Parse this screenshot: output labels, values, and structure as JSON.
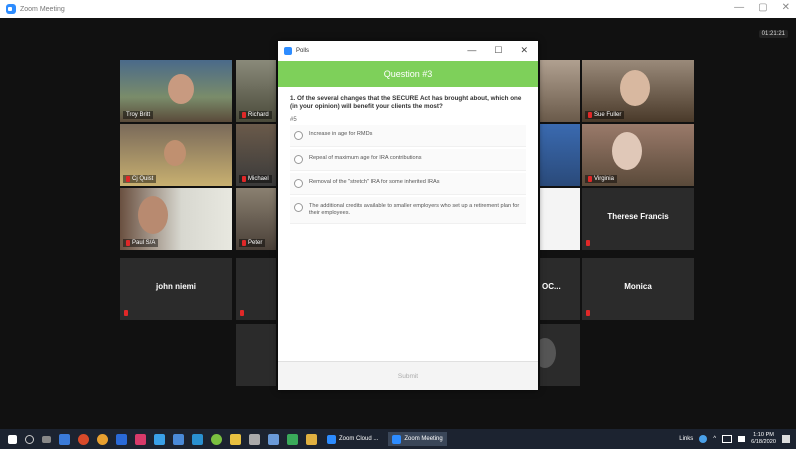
{
  "window": {
    "title": "Zoom Meeting",
    "controls": [
      "—",
      "▢",
      "✕"
    ]
  },
  "meeting": {
    "timer": "01:21:21"
  },
  "participants": [
    {
      "name": "Troy Britt",
      "muted": false
    },
    {
      "name": "Richard",
      "muted": true
    },
    {
      "name": "Sue Fuller",
      "muted": true
    },
    {
      "name": "Cj Quist",
      "muted": true
    },
    {
      "name": "Michael",
      "muted": true
    },
    {
      "name": "Virginia",
      "muted": true
    },
    {
      "name": "Paul S/A",
      "muted": true
    },
    {
      "name": "Peter",
      "muted": true
    },
    {
      "name": "Therese Francis",
      "muted": true
    },
    {
      "name": "john niemi",
      "muted": true
    },
    {
      "name": "OC...",
      "muted": false
    },
    {
      "name": "Monica",
      "muted": true
    }
  ],
  "poll": {
    "window_title": "Polls",
    "controls": [
      "—",
      "☐",
      "✕"
    ],
    "header": "Question #3",
    "question": "1. Of the several changes that the SECURE Act has brought about, which one (in your opinion) will benefit your clients the most?",
    "number_label": "#5",
    "options": [
      "Increase in age for RMDs",
      "Repeal of maximum age for IRA contributions",
      "Removal of the \"stretch\" IRA for some inherited IRAs",
      "The additional credits available to smaller employers who set up a retirement plan for their employees."
    ],
    "submit_label": "Submit"
  },
  "taskbar": {
    "apps": [
      {
        "label": "Zoom Cloud ..."
      },
      {
        "label": "Zoom Meeting"
      }
    ],
    "links_label": "Links",
    "time": "1:10 PM",
    "date": "6/18/2020"
  }
}
